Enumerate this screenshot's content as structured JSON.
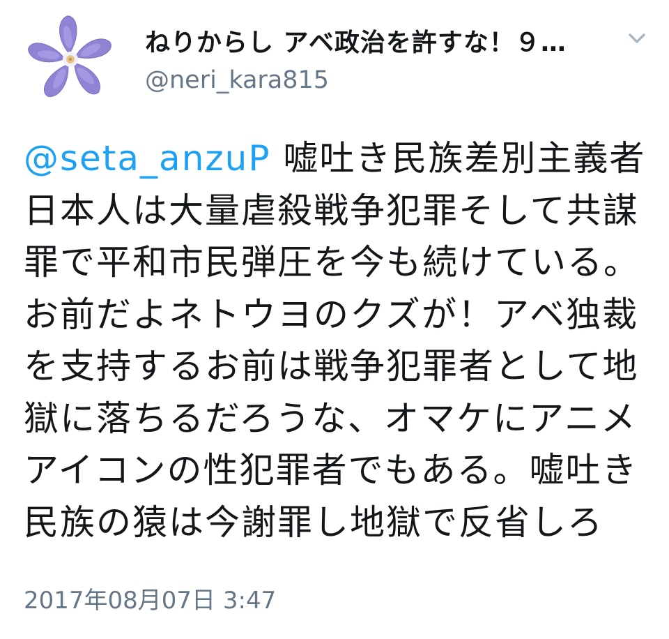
{
  "user": {
    "display_name": "ねりからし アベ政治を許すな！９…",
    "handle": "@neri_kara815",
    "avatar_icon": "periwinkle-flower-icon"
  },
  "menu": {
    "icon": "chevron-down-icon"
  },
  "tweet": {
    "mention": "@seta_anzuP",
    "body": " 嘘吐き民族差別主義者日本人は大量虐殺戦争犯罪そして共謀罪で平和市民弾圧を今も続けている。お前だよネトウヨのクズが！アベ独裁を支持するお前は戦争犯罪者として地獄に落ちるだろうな、オマケにアニメアイコンの性犯罪者でもある。嘘吐き民族の猿は今謝罪し地獄で反省しろ",
    "timestamp": "2017年08月07日 3:47"
  },
  "colors": {
    "link": "#1da1f2",
    "secondary_text": "#657786",
    "primary_text": "#14171a",
    "flower": "#8f83d4"
  }
}
